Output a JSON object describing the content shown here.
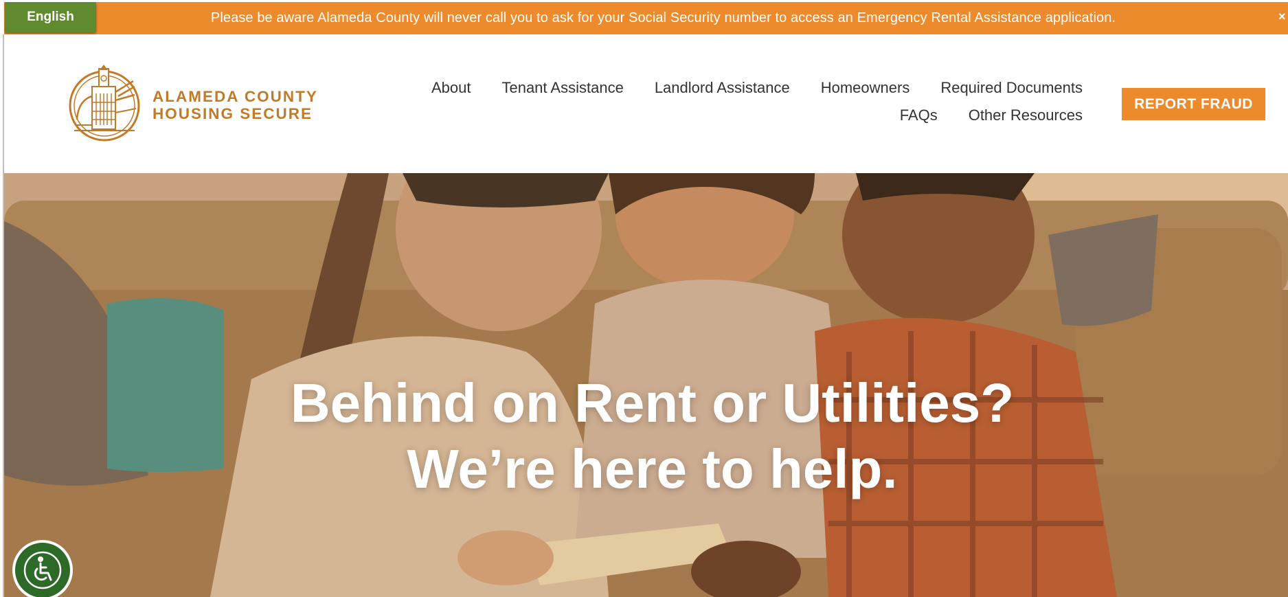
{
  "alert": {
    "message": "Please be aware Alameda County will never call you to ask for your Social Security number to access an Emergency Rental Assistance application.",
    "close_label": "×"
  },
  "language": {
    "selected": "English"
  },
  "logo": {
    "line1": "ALAMEDA COUNTY",
    "line2": "HOUSING SECURE"
  },
  "nav": {
    "row1": [
      "About",
      "Tenant Assistance",
      "Landlord Assistance",
      "Homeowners",
      "Required Documents"
    ],
    "row2": [
      "FAQs",
      "Other Resources"
    ]
  },
  "report_fraud": {
    "label": "REPORT FRAUD"
  },
  "hero": {
    "line1": "Behind on Rent or Utilities?",
    "line2": "We’re here to help."
  },
  "colors": {
    "accent": "#ec8a2c",
    "language_button": "#5f8a2d",
    "logo": "#c27a26",
    "accessibility": "#2e6a27"
  },
  "icons": {
    "logo": "city-hall-seal-icon",
    "accessibility": "wheelchair-icon",
    "close": "close-icon"
  }
}
